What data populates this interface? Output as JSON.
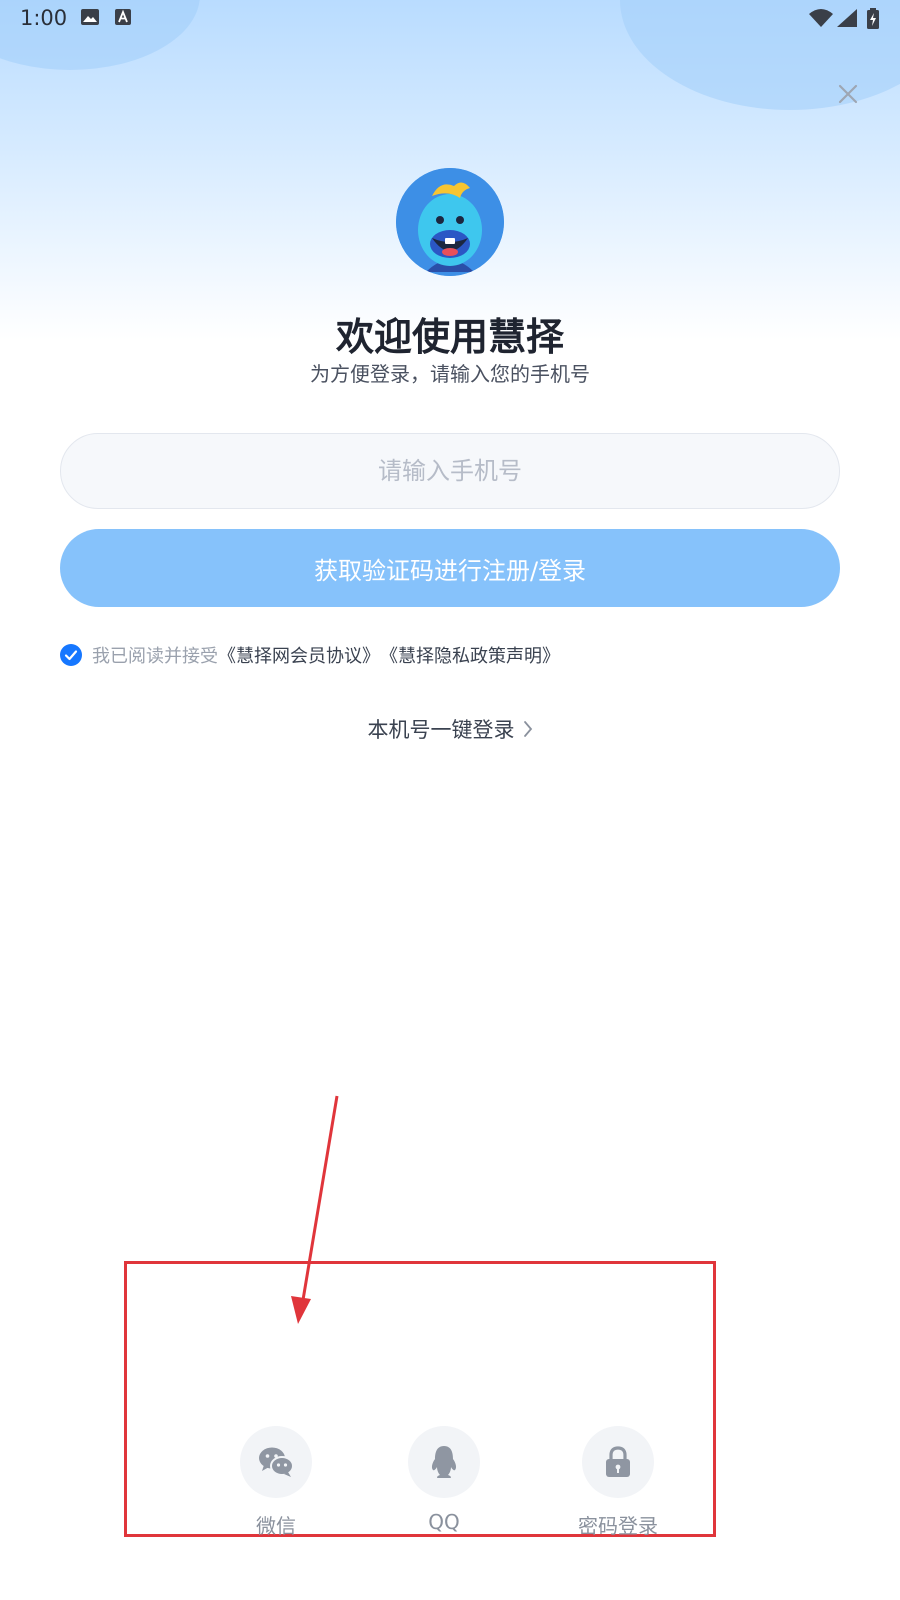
{
  "status_bar": {
    "time": "1:00",
    "icons": [
      "image-icon",
      "a-icon",
      "wifi-icon",
      "signal-icon",
      "battery-icon"
    ]
  },
  "header": {
    "close_icon": "close-icon"
  },
  "welcome": {
    "title": "欢迎使用慧择",
    "subtitle": "为方便登录，请输入您的手机号"
  },
  "phone_input": {
    "value": "",
    "placeholder": "请输入手机号"
  },
  "submit_button": {
    "label": "获取验证码进行注册/登录"
  },
  "agreement": {
    "checked": true,
    "prefix": "我已阅读并接受",
    "member_agreement": "《慧择网会员协议》",
    "privacy_policy": "《慧择隐私政策声明》"
  },
  "one_click_login": {
    "label": "本机号一键登录"
  },
  "social_login": [
    {
      "label": "微信",
      "icon": "wechat-icon"
    },
    {
      "label": "QQ",
      "icon": "qq-icon"
    },
    {
      "label": "密码登录",
      "icon": "lock-icon"
    }
  ],
  "colors": {
    "primary_button": "#86c2fb",
    "check_accent": "#1677ff",
    "annotation": "#e0353b"
  }
}
